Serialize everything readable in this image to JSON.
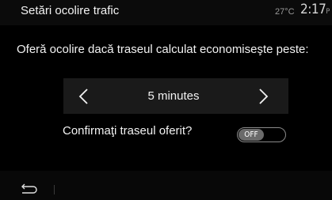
{
  "header": {
    "title": "Setări ocolire trafic",
    "temperature": "27°C",
    "time": "2:17",
    "time_suffix": "P"
  },
  "question": "Oferă ocolire dacă traseul calculat economiseşte peste:",
  "stepper": {
    "value": "5 minutes",
    "decrease_icon": "chevron-left-icon",
    "increase_icon": "chevron-right-icon"
  },
  "confirm": {
    "label": "Confirmaţi traseul oferit?",
    "toggle_state": "OFF"
  },
  "footer": {
    "back_icon": "back-arrow-icon"
  },
  "colors": {
    "background": "#000000",
    "stepper_bg": "#1a1a1a",
    "toggle_knob": "#6a6a6a",
    "text": "#f2f2f2"
  }
}
